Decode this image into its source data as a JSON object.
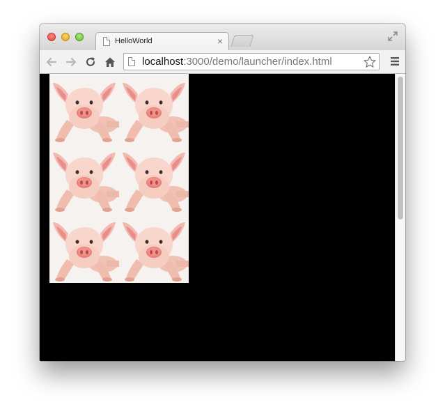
{
  "window": {
    "controls": [
      "close",
      "minimize",
      "zoom"
    ]
  },
  "tabs": [
    {
      "title": "HelloWorld",
      "icon": "document-icon",
      "active": true
    }
  ],
  "toolbar": {
    "url_host": "localhost",
    "url_path": ":3000/demo/launcher/index.html",
    "icons": [
      "back-arrow-icon",
      "forward-arrow-icon",
      "reload-icon",
      "home-icon",
      "star-icon",
      "menu-icon"
    ]
  },
  "content": {
    "background": "#000000",
    "image_tiles": 6,
    "image_subject": "piglet"
  },
  "colors": {
    "close": "#e0443e",
    "minimize": "#dea123",
    "zoom": "#5fb82e"
  }
}
